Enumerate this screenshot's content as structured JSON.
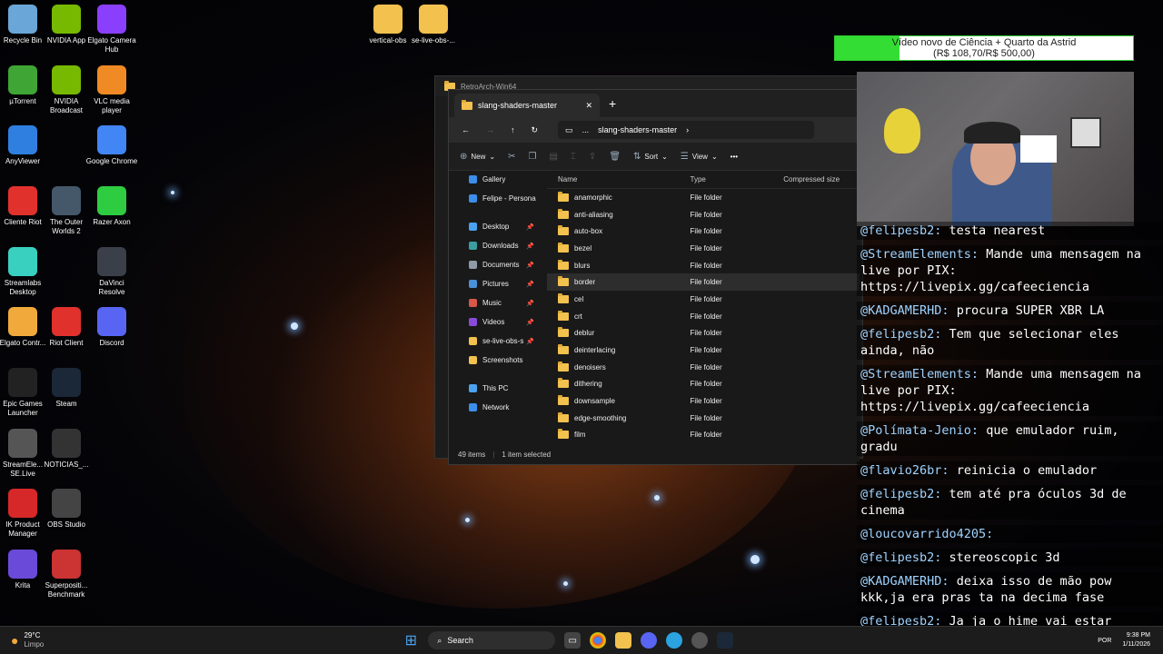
{
  "desktop_icons": [
    {
      "label": "Recycle Bin",
      "icon": "recycle-bin-icon"
    },
    {
      "label": "NVIDIA App",
      "icon": "nvidia-icon"
    },
    {
      "label": "Elgato Camera Hub",
      "icon": "elgato-camera-icon"
    },
    {
      "label": "µTorrent",
      "icon": "utorrent-icon"
    },
    {
      "label": "NVIDIA Broadcast",
      "icon": "nvidia-broadcast-icon"
    },
    {
      "label": "VLC media player",
      "icon": "vlc-icon"
    },
    {
      "label": "AnyViewer",
      "icon": "anyviewer-icon"
    },
    {
      "label": "Google Chrome",
      "icon": "chrome-icon"
    },
    {
      "label": "Cliente Riot",
      "icon": "riot-icon"
    },
    {
      "label": "The Outer Worlds 2",
      "icon": "game-icon"
    },
    {
      "label": "Razer Axon",
      "icon": "razer-icon"
    },
    {
      "label": "Streamlabs Desktop",
      "icon": "streamlabs-icon"
    },
    {
      "label": "DaVinci Resolve",
      "icon": "davinci-icon"
    },
    {
      "label": "Elgato Contr...",
      "icon": "elgato-control-icon"
    },
    {
      "label": "Riot Client",
      "icon": "riot-client-icon"
    },
    {
      "label": "Discord",
      "icon": "discord-icon"
    },
    {
      "label": "Epic Games Launcher",
      "icon": "epic-icon"
    },
    {
      "label": "Steam",
      "icon": "steam-icon"
    },
    {
      "label": "StreamEle... SE.Live",
      "icon": "streamelements-icon"
    },
    {
      "label": "NOTICIAS_...",
      "icon": "image-icon"
    },
    {
      "label": "IK Product Manager",
      "icon": "ik-icon"
    },
    {
      "label": "OBS Studio",
      "icon": "obs-icon"
    },
    {
      "label": "Krita",
      "icon": "krita-icon"
    },
    {
      "label": "Superpositi... Benchmark",
      "icon": "benchmark-icon"
    },
    {
      "label": "vertical-obs",
      "icon": "folder-icon"
    },
    {
      "label": "se-live-obs-...",
      "icon": "folder-icon"
    }
  ],
  "back_window": {
    "tab_title": "RetroArch-Win64"
  },
  "explorer": {
    "tab_title": "slang-shaders-master",
    "breadcrumb": [
      "...",
      "slang-shaders-master"
    ],
    "commands": {
      "new": "New",
      "sort": "Sort",
      "view": "View"
    },
    "nav": [
      {
        "label": "Gallery",
        "pinned": false,
        "color": "#3b8eea"
      },
      {
        "label": "Felipe - Persona",
        "pinned": false,
        "color": "#3b8eea"
      },
      {
        "label": "Desktop",
        "pinned": true,
        "color": "#4aa3f0"
      },
      {
        "label": "Downloads",
        "pinned": true,
        "color": "#3b9ea0"
      },
      {
        "label": "Documents",
        "pinned": true,
        "color": "#8e9aa8"
      },
      {
        "label": "Pictures",
        "pinned": true,
        "color": "#4a90d9"
      },
      {
        "label": "Music",
        "pinned": true,
        "color": "#d9564a"
      },
      {
        "label": "Videos",
        "pinned": true,
        "color": "#8a4ad9"
      },
      {
        "label": "se-live-obs-s",
        "pinned": true,
        "color": "#f2c14e"
      },
      {
        "label": "Screenshots",
        "pinned": false,
        "color": "#f2c14e"
      },
      {
        "label": "This PC",
        "pinned": false,
        "color": "#4aa3f0"
      },
      {
        "label": "Network",
        "pinned": false,
        "color": "#3b8eea"
      }
    ],
    "columns": {
      "name": "Name",
      "type": "Type",
      "compressed": "Compressed size"
    },
    "rows": [
      {
        "name": "anamorphic",
        "type": "File folder"
      },
      {
        "name": "anti-aliasing",
        "type": "File folder"
      },
      {
        "name": "auto-box",
        "type": "File folder"
      },
      {
        "name": "bezel",
        "type": "File folder"
      },
      {
        "name": "blurs",
        "type": "File folder"
      },
      {
        "name": "border",
        "type": "File folder"
      },
      {
        "name": "cel",
        "type": "File folder"
      },
      {
        "name": "crt",
        "type": "File folder"
      },
      {
        "name": "deblur",
        "type": "File folder"
      },
      {
        "name": "deinterlacing",
        "type": "File folder"
      },
      {
        "name": "denoisers",
        "type": "File folder"
      },
      {
        "name": "dithering",
        "type": "File folder"
      },
      {
        "name": "downsample",
        "type": "File folder"
      },
      {
        "name": "edge-smoothing",
        "type": "File folder"
      },
      {
        "name": "film",
        "type": "File folder"
      }
    ],
    "selected_row": "border",
    "status_items": "49 items",
    "status_selected": "1 item selected"
  },
  "donation": {
    "line1": "Vídeo novo de Ciência + Quarto da Astrid",
    "line2": "(R$ 108,70/R$ 500,00)",
    "progress": 0.217
  },
  "chat": [
    {
      "user": "@felipesb2:",
      "text": "testa nearest"
    },
    {
      "user": "@StreamElements:",
      "text": "Mande uma mensagem na live por PIX: https://livepix.gg/cafeeciencia"
    },
    {
      "user": "@KADGAMERHD:",
      "text": "procura SUPER XBR LA"
    },
    {
      "user": "@felipesb2:",
      "text": "Tem que selecionar eles ainda, não"
    },
    {
      "user": "@StreamElements:",
      "text": "Mande uma mensagem na live por PIX: https://livepix.gg/cafeeciencia"
    },
    {
      "user": "@Polímata-Jenio:",
      "text": "que emulador ruim, gradu"
    },
    {
      "user": "@flavio26br:",
      "text": "reinicia o emulador"
    },
    {
      "user": "@felipesb2:",
      "text": "tem até pra óculos 3d de cinema"
    },
    {
      "user": "@loucovarrido4205:",
      "text": ""
    },
    {
      "user": "@felipesb2:",
      "text": "stereoscopic 3d"
    },
    {
      "user": "@KADGAMERHD:",
      "text": "deixa isso de mão pow kkk,ja era pras ta na decima fase"
    },
    {
      "user": "@felipesb2:",
      "text": "Ja ja o hime vai estar programando em python o algoritmo de"
    }
  ],
  "taskbar": {
    "weather_temp": "29°C",
    "weather_desc": "Limpo",
    "search_placeholder": "Search",
    "lang": "POR",
    "time": "9:38 PM",
    "date": "1/11/2026"
  }
}
